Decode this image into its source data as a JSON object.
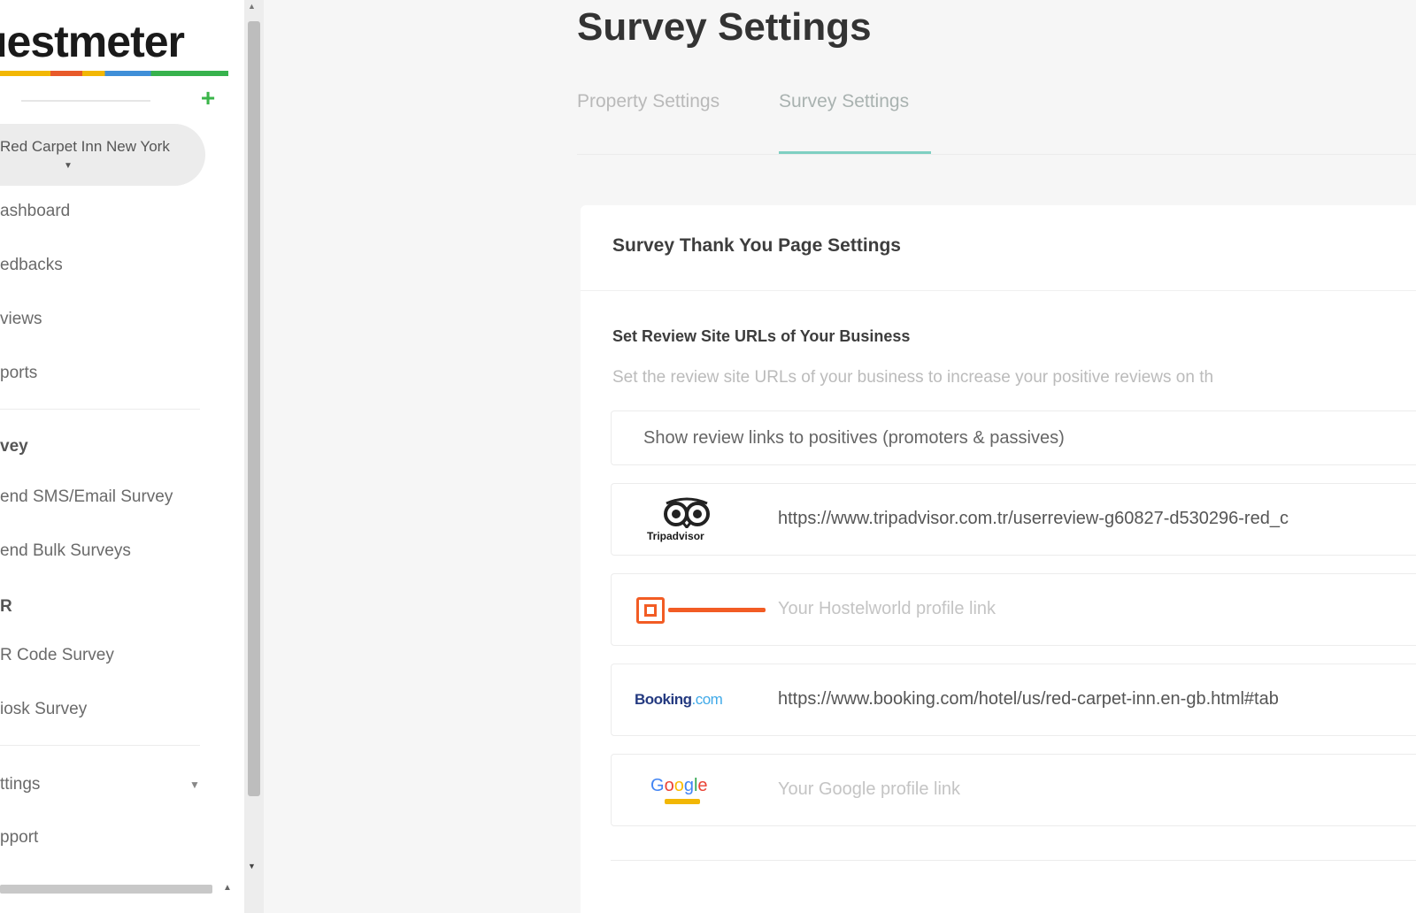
{
  "sidebar": {
    "brand": "uestmeter",
    "property_selector": "Red Carpet Inn New York",
    "nav": {
      "dashboard": "ashboard",
      "feedbacks": "edbacks",
      "reviews": "views",
      "reports": "ports",
      "survey_section": "vey",
      "send_sms_email": "end SMS/Email Survey",
      "send_bulk": "end Bulk Surveys",
      "qr_section": "R",
      "qr_code_survey": "R Code Survey",
      "kiosk_survey": "iosk Survey",
      "settings": "ttings",
      "support": "pport"
    }
  },
  "header": {
    "title": "Survey Settings",
    "tabs": [
      {
        "label": "Property Settings",
        "active": false
      },
      {
        "label": "Survey Settings",
        "active": true
      }
    ]
  },
  "card": {
    "title": "Survey Thank You Page Settings",
    "section_title": "Set Review Site URLs of Your Business",
    "section_desc": "Set the review site URLs of your business to increase your positive reviews on th",
    "display_filter": "Show review links to positives (promoters & passives)",
    "review_sites": [
      {
        "site": "TripAdvisor",
        "value": "https://www.tripadvisor.com.tr/userreview-g60827-d530296-red_c",
        "placeholder": ""
      },
      {
        "site": "Hostelworld",
        "value": "",
        "placeholder": "Your Hostelworld profile link"
      },
      {
        "site": "Booking.com",
        "value": "https://www.booking.com/hotel/us/red-carpet-inn.en-gb.html#tab",
        "placeholder": ""
      },
      {
        "site": "Google",
        "value": "",
        "placeholder": "Your Google profile link"
      }
    ]
  },
  "brand_marks": {
    "tripadvisor_word": "Tripadvisor",
    "booking_word_main": "Booking",
    "booking_word_suffix": ".com",
    "google_word": "Google"
  },
  "colors": {
    "accent": "#7fcfc2",
    "add_green": "#3bb54a",
    "hostelworld_orange": "#f25c24",
    "booking_navy": "#243a80",
    "tripadvisor_green": "#34e0a1"
  }
}
